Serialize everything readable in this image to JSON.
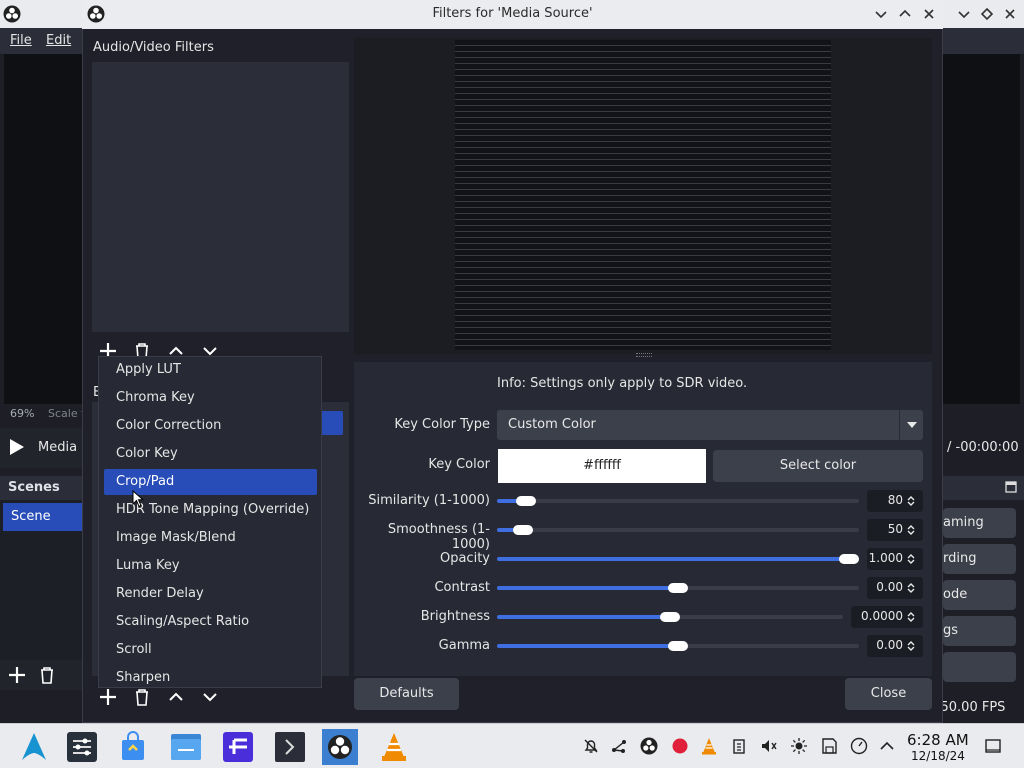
{
  "obs_main": {
    "menu": [
      {
        "label": "File"
      },
      {
        "label": "Edit"
      }
    ],
    "zoom": "69%",
    "scale_text": "Scale t",
    "media_name": "Media s",
    "timecode": "/ -00:00:00",
    "scenes_header": "Scenes",
    "scenes": [
      {
        "label": "Scene"
      }
    ],
    "controls": [
      {
        "label": "aming"
      },
      {
        "label": "rding"
      },
      {
        "label": "ode"
      },
      {
        "label": "gs"
      }
    ],
    "fps": "/ 50.00 FPS"
  },
  "dialog": {
    "title": "Filters for 'Media Source'",
    "av_filters_label": "Audio/Video Filters",
    "effects_label": "E",
    "info": "Info: Settings only apply to SDR video.",
    "key_color_type": {
      "label": "Key Color Type",
      "value": "Custom Color"
    },
    "key_color": {
      "label": "Key Color",
      "value": "#ffffff",
      "button": "Select color"
    },
    "sliders": [
      {
        "label": "Similarity (1-1000)",
        "value": "80",
        "fraction": 0.08
      },
      {
        "label": "Smoothness (1-1000)",
        "value": "50",
        "fraction": 0.05
      },
      {
        "label": "Opacity",
        "value": "1.000",
        "fraction": 1.0
      },
      {
        "label": "Contrast",
        "value": "0.00",
        "fraction": 0.5
      },
      {
        "label": "Brightness",
        "value": "0.0000",
        "fraction": 0.5
      },
      {
        "label": "Gamma",
        "value": "0.00",
        "fraction": 0.5
      }
    ],
    "defaults_button": "Defaults",
    "close_button": "Close"
  },
  "add_filter_menu": {
    "items": [
      {
        "label": "Apply LUT",
        "selected": false
      },
      {
        "label": "Chroma Key",
        "selected": false
      },
      {
        "label": "Color Correction",
        "selected": false
      },
      {
        "label": "Color Key",
        "selected": false
      },
      {
        "label": "Crop/Pad",
        "selected": true
      },
      {
        "label": "HDR Tone Mapping (Override)",
        "selected": false
      },
      {
        "label": "Image Mask/Blend",
        "selected": false
      },
      {
        "label": "Luma Key",
        "selected": false
      },
      {
        "label": "Render Delay",
        "selected": false
      },
      {
        "label": "Scaling/Aspect Ratio",
        "selected": false
      },
      {
        "label": "Scroll",
        "selected": false
      },
      {
        "label": "Sharpen",
        "selected": false
      }
    ]
  },
  "taskbar": {
    "apps": [
      {
        "icon": "arch-launcher-icon"
      },
      {
        "icon": "settings-mixer-icon"
      },
      {
        "icon": "store-bag-icon"
      },
      {
        "icon": "file-manager-icon"
      },
      {
        "icon": "f-app-icon"
      },
      {
        "icon": "terminal-icon"
      },
      {
        "icon": "obs-icon"
      },
      {
        "icon": "vlc-icon"
      }
    ],
    "time": "6:28 AM",
    "date": "12/18/24"
  },
  "colors": {
    "accent": "#284cb8",
    "slider_fill": "#3f6ee0",
    "panel": "#2b2e38",
    "background": "#1f2029"
  }
}
